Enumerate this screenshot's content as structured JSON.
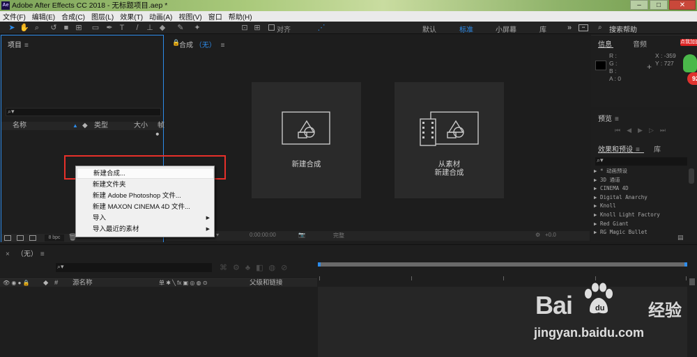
{
  "window": {
    "title": "Adobe After Effects CC 2018 - 无标题项目.aep *",
    "app_icon": "Ae"
  },
  "menu": [
    "文件(F)",
    "编辑(E)",
    "合成(C)",
    "图层(L)",
    "效果(T)",
    "动画(A)",
    "视图(V)",
    "窗口",
    "帮助(H)"
  ],
  "toolbar": {
    "align_label": "对齐",
    "workspaces": [
      "默认",
      "标准",
      "小屏幕",
      "库"
    ],
    "active_workspace": "标准",
    "search_help": "搜索帮助"
  },
  "project": {
    "title": "项目",
    "columns": [
      "名称",
      "类型",
      "大小",
      "帧"
    ],
    "bpc": "8 bpc"
  },
  "composition": {
    "title": "合成",
    "value": "（无）",
    "new_comp_label": "新建合成",
    "from_footage_line1": "从素材",
    "from_footage_line2": "新建合成",
    "zoom_label": "完整",
    "timecode": "0:00:00:00",
    "exposure": "+0.0"
  },
  "info": {
    "tab_info": "信息",
    "tab_audio": "音频",
    "r": "R :",
    "g": "G :",
    "b": "B :",
    "a": "A : 0",
    "x": "X : -359",
    "y": "Y : 727"
  },
  "badge": {
    "tag": "点我加速",
    "number": "92"
  },
  "preview": {
    "title": "预览"
  },
  "effects": {
    "tab_effects": "效果和预设",
    "tab_library": "库",
    "items": [
      "▶ * 动画预设",
      "▶ 3D 通道",
      "▶ CINEMA 4D",
      "▶ Digital Anarchy",
      "▶ Knoll",
      "▶ Knoll Light Factory",
      "▶ Red Giant",
      "▶ RG Magic Bullet"
    ]
  },
  "context_menu": {
    "items": [
      {
        "label": "新建合成...",
        "submenu": false,
        "highlighted": true
      },
      {
        "label": "新建文件夹",
        "submenu": false,
        "highlighted": false
      },
      {
        "label": "新建 Adobe Photoshop 文件...",
        "submenu": false,
        "highlighted": false
      },
      {
        "label": "新建 MAXON CINEMA 4D 文件...",
        "submenu": false,
        "highlighted": false
      },
      {
        "label": "导入",
        "submenu": true,
        "highlighted": false
      },
      {
        "label": "导入最近的素材",
        "submenu": true,
        "highlighted": false
      }
    ]
  },
  "timeline": {
    "title": "（无）",
    "col_hash": "#",
    "col_source": "源名称",
    "col_switches": "单 ✱ ╲ fx ▣ ◎ ◍ ⊙",
    "col_parent": "父级和链接"
  },
  "watermark": {
    "logo_left": "Bai",
    "logo_right": "经验",
    "url": "jingyan.baidu.com"
  },
  "colors": {
    "accent": "#2d8ceb",
    "highlight_box": "#e8302a"
  }
}
